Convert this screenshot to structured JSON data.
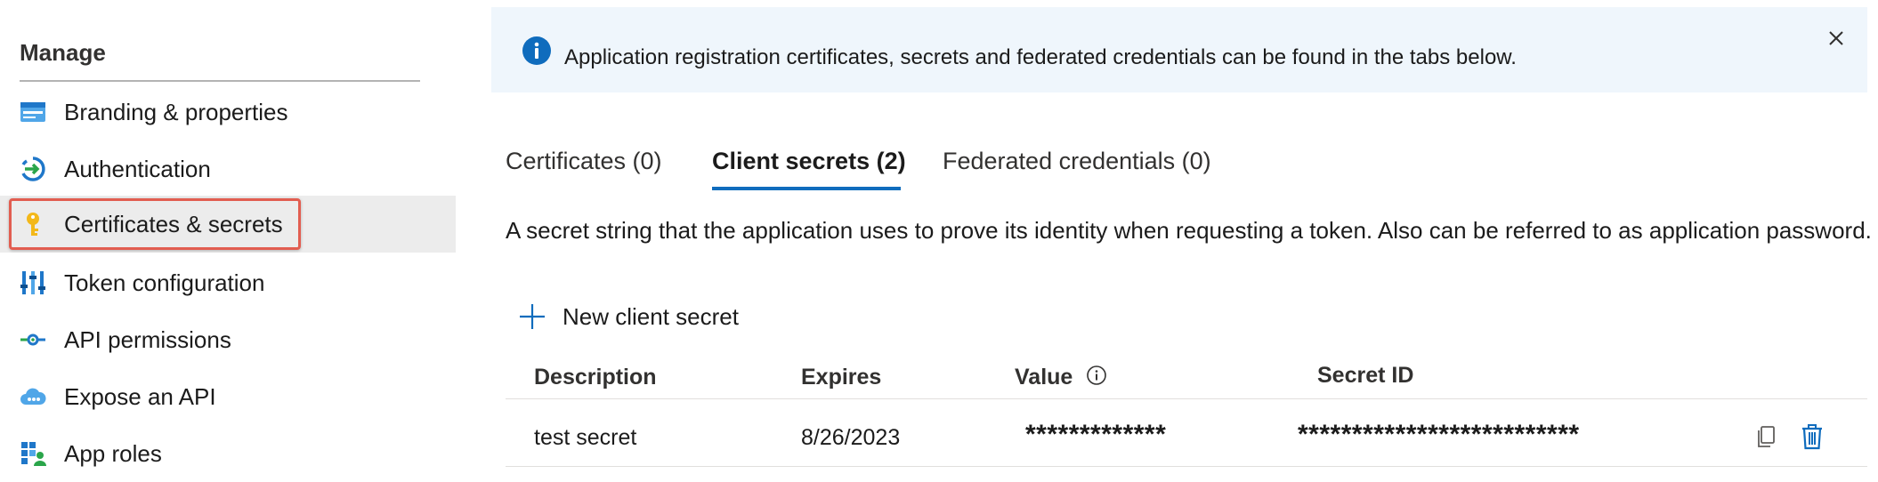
{
  "sidebar": {
    "section_title": "Manage",
    "items": [
      {
        "label": "Branding & properties",
        "icon": "branding-icon"
      },
      {
        "label": "Authentication",
        "icon": "authentication-icon"
      },
      {
        "label": "Certificates & secrets",
        "icon": "key-icon",
        "selected": true
      },
      {
        "label": "Token configuration",
        "icon": "token-config-icon"
      },
      {
        "label": "API permissions",
        "icon": "api-permissions-icon"
      },
      {
        "label": "Expose an API",
        "icon": "cloud-api-icon"
      },
      {
        "label": "App roles",
        "icon": "app-roles-icon"
      }
    ]
  },
  "banner": {
    "text": "Application registration certificates, secrets and federated credentials can be found in the tabs below.",
    "icon": "info-icon",
    "close_icon": "close-icon"
  },
  "tabs": [
    {
      "label": "Certificates (0)",
      "active": false
    },
    {
      "label": "Client secrets (2)",
      "active": true
    },
    {
      "label": "Federated credentials (0)",
      "active": false
    }
  ],
  "description": "A secret string that the application uses to prove its identity when requesting a token. Also can be referred to as application password.",
  "actions": {
    "new_client_secret": "New client secret"
  },
  "table": {
    "headers": {
      "description": "Description",
      "expires": "Expires",
      "value": "Value",
      "secret_id": "Secret ID"
    },
    "rows": [
      {
        "description": "test secret",
        "expires": "8/26/2023",
        "value": "*************",
        "secret_id": "**************************"
      }
    ]
  },
  "colors": {
    "accent": "#0f6cbd",
    "highlight": "#e25d50",
    "banner_bg": "#eff6fc",
    "selected_bg": "#ececec"
  }
}
